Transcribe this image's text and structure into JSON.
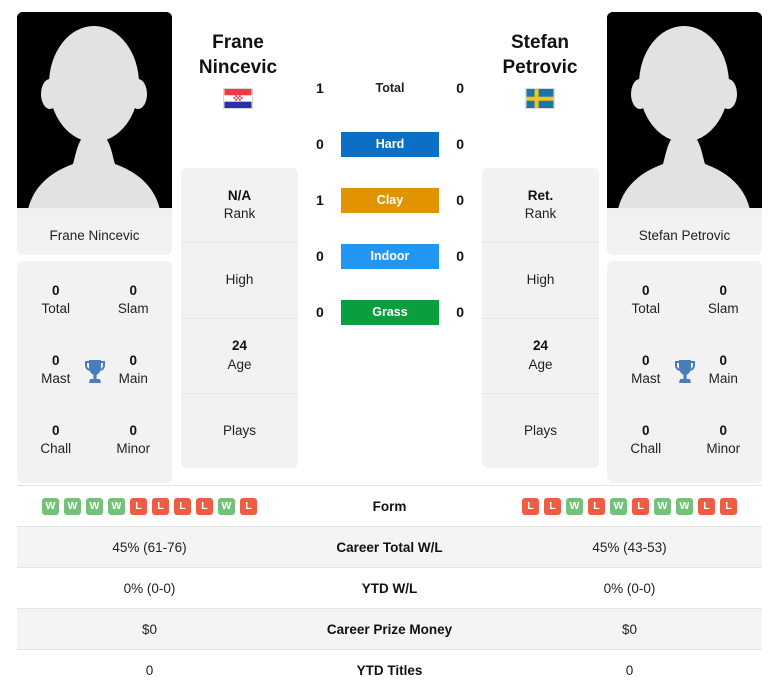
{
  "players": {
    "left": {
      "first_name": "Frane",
      "last_name": "Nincevic",
      "full_name": "Frane Nincevic",
      "flag": "croatia-flag",
      "rank": "N/A",
      "rank_label": "Rank",
      "high": "",
      "high_label": "High",
      "age": "24",
      "age_label": "Age",
      "plays": "",
      "plays_label": "Plays",
      "titles": [
        {
          "num": "0",
          "label": "Total"
        },
        {
          "num": "0",
          "label": "Slam"
        },
        {
          "num": "0",
          "label": "Mast"
        },
        {
          "num": "0",
          "label": "Main"
        },
        {
          "num": "0",
          "label": "Chall"
        },
        {
          "num": "0",
          "label": "Minor"
        }
      ],
      "form": [
        "W",
        "W",
        "W",
        "W",
        "L",
        "L",
        "L",
        "L",
        "W",
        "L"
      ]
    },
    "right": {
      "first_name": "Stefan",
      "last_name": "Petrovic",
      "full_name": "Stefan Petrovic",
      "flag": "sweden-flag",
      "rank": "Ret.",
      "rank_label": "Rank",
      "high": "",
      "high_label": "High",
      "age": "24",
      "age_label": "Age",
      "plays": "",
      "plays_label": "Plays",
      "titles": [
        {
          "num": "0",
          "label": "Total"
        },
        {
          "num": "0",
          "label": "Slam"
        },
        {
          "num": "0",
          "label": "Mast"
        },
        {
          "num": "0",
          "label": "Main"
        },
        {
          "num": "0",
          "label": "Chall"
        },
        {
          "num": "0",
          "label": "Minor"
        }
      ],
      "form": [
        "L",
        "L",
        "W",
        "L",
        "W",
        "L",
        "W",
        "W",
        "L",
        "L"
      ]
    }
  },
  "surfaces": [
    {
      "label": "Total",
      "left": "1",
      "right": "0",
      "color": "",
      "style": "plain"
    },
    {
      "label": "Hard",
      "left": "0",
      "right": "0",
      "color": "#0b6fc4",
      "style": "badge"
    },
    {
      "label": "Clay",
      "left": "1",
      "right": "0",
      "color": "#e09400",
      "style": "badge"
    },
    {
      "label": "Indoor",
      "left": "0",
      "right": "0",
      "color": "#2196f3",
      "style": "badge"
    },
    {
      "label": "Grass",
      "left": "0",
      "right": "0",
      "color": "#0a9e3f",
      "style": "badge"
    }
  ],
  "comparison_rows": [
    {
      "label": "Form",
      "type": "form",
      "left": "",
      "right": ""
    },
    {
      "label": "Career Total W/L",
      "type": "text",
      "left": "45% (61-76)",
      "right": "45% (43-53)"
    },
    {
      "label": "YTD W/L",
      "type": "text",
      "left": "0% (0-0)",
      "right": "0% (0-0)"
    },
    {
      "label": "Career Prize Money",
      "type": "text",
      "left": "$0",
      "right": "$0"
    },
    {
      "label": "YTD Titles",
      "type": "text",
      "left": "0",
      "right": "0"
    }
  ],
  "colors": {
    "win_badge": "#74c27a",
    "loss_badge": "#ef5b43",
    "trophy": "#4a7ebb",
    "card_bg": "#f2f2f2",
    "row_shade": "#f4f4f4"
  }
}
